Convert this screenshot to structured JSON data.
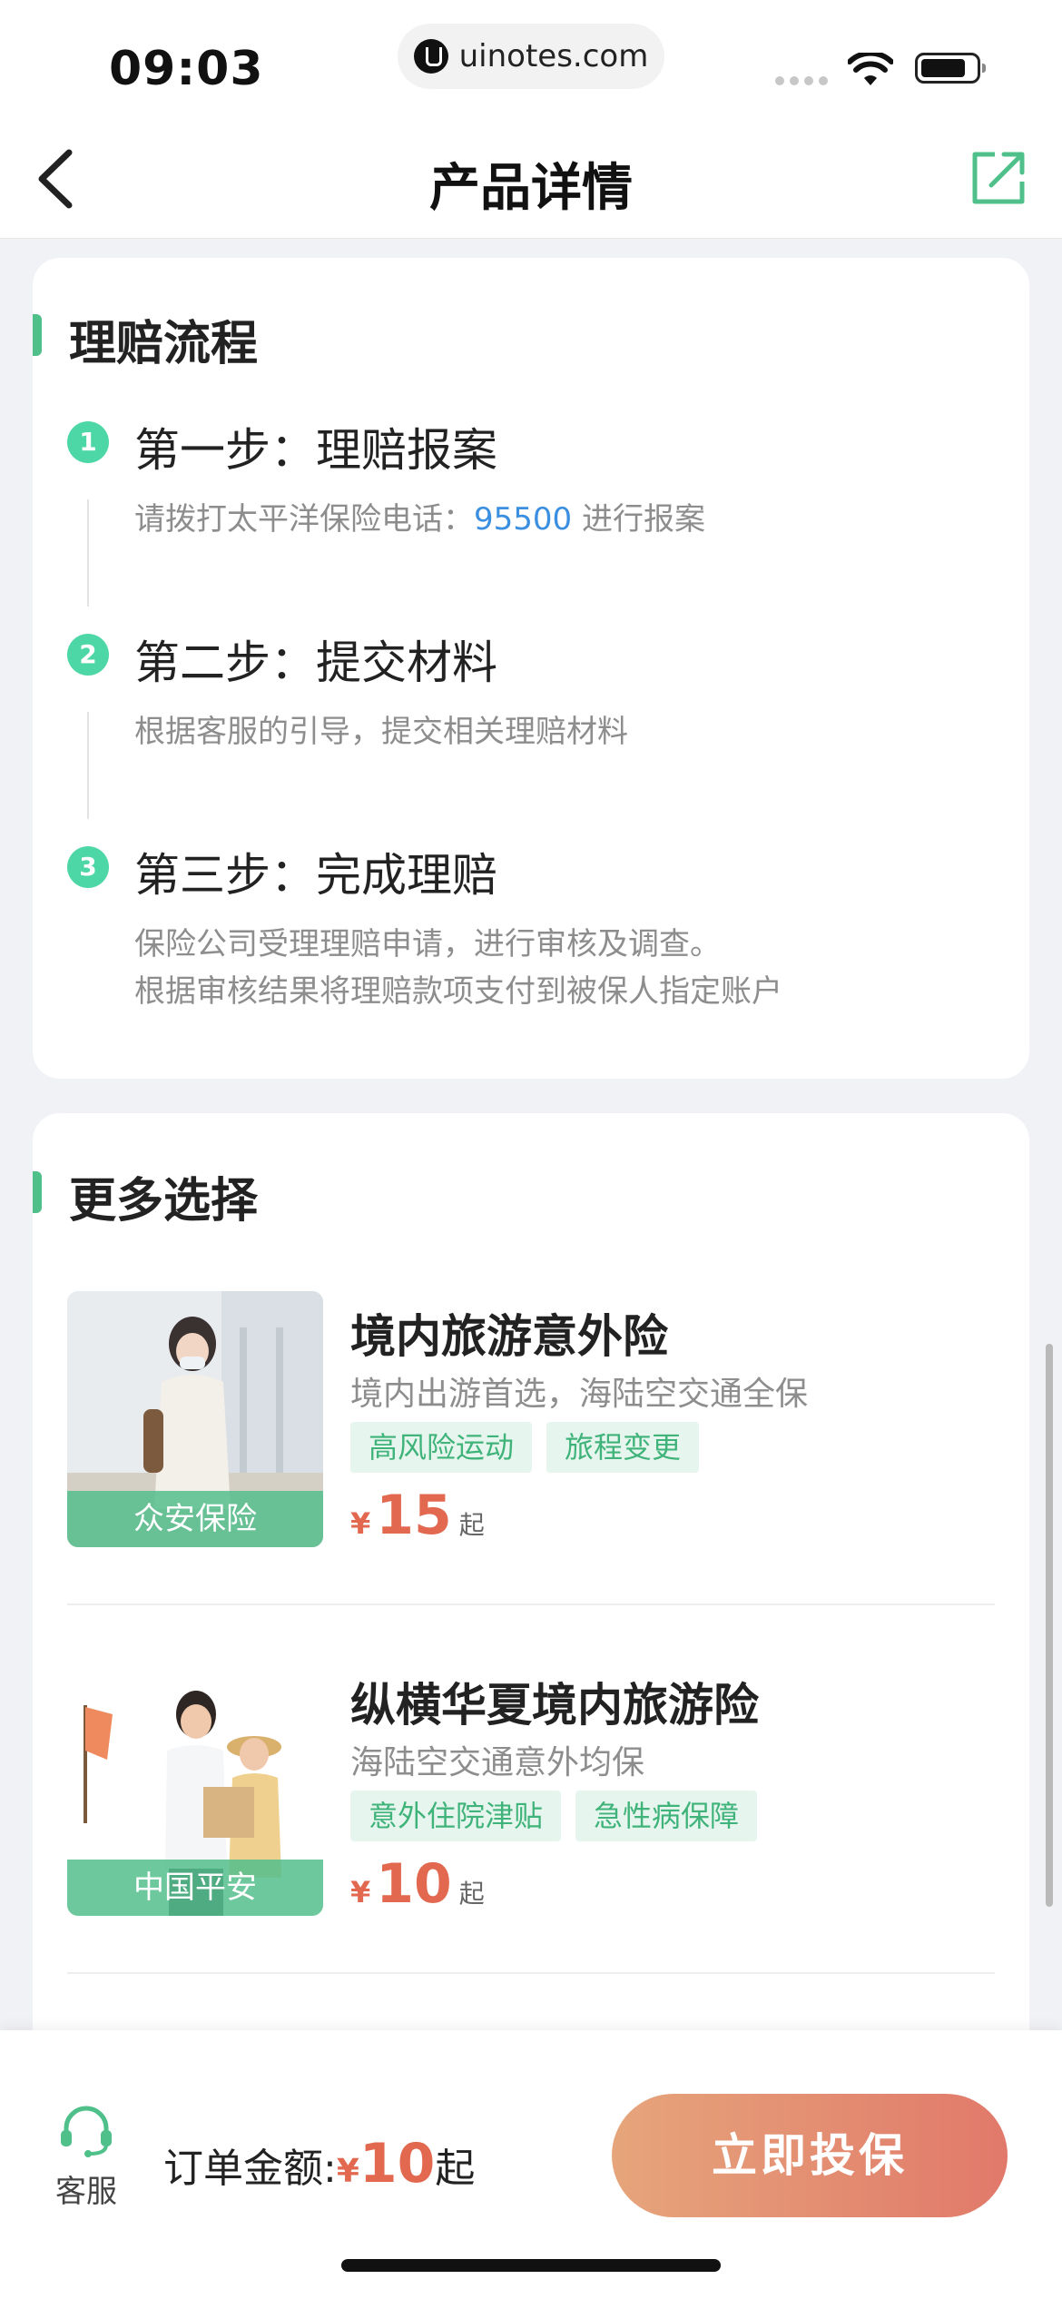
{
  "status_bar": {
    "time": "09:03",
    "url": "uinotes.com"
  },
  "nav": {
    "title": "产品详情"
  },
  "claims": {
    "title": "理赔流程",
    "steps": [
      {
        "num": "1",
        "title": "第一步：理赔报案",
        "desc_prefix": "请拨打太平洋保险电话：",
        "hotline": "95500",
        "desc_suffix": " 进行报案"
      },
      {
        "num": "2",
        "title": "第二步：提交材料",
        "desc": "根据客服的引导，提交相关理赔材料"
      },
      {
        "num": "3",
        "title": "第三步：完成理赔",
        "desc_line1": "保险公司受理理赔申请，进行审核及调查。",
        "desc_line2": "根据审核结果将理赔款项支付到被保人指定账户"
      }
    ]
  },
  "more": {
    "title": "更多选择",
    "products": [
      {
        "brand": "众安保险",
        "name": "境内旅游意外险",
        "desc": "境内出游首选，海陆空交通全保",
        "tags": [
          "高风险运动",
          "旅程变更"
        ],
        "currency": "¥",
        "price": "15",
        "suffix": "起"
      },
      {
        "brand": "中国平安",
        "name": "纵横华夏境内旅游险",
        "desc": "海陆空交通意外均保",
        "tags": [
          "意外住院津贴",
          "急性病保障"
        ],
        "currency": "¥",
        "price": "10",
        "suffix": "起"
      }
    ]
  },
  "bottom": {
    "service_label": "客服",
    "order_label": "订单金额:",
    "currency": "¥",
    "amount": "10",
    "suffix": "起",
    "buy_label": "立即投保"
  },
  "colors": {
    "accent_green": "#4fc089",
    "price_red": "#e2694f",
    "link_blue": "#3a8fe0"
  }
}
